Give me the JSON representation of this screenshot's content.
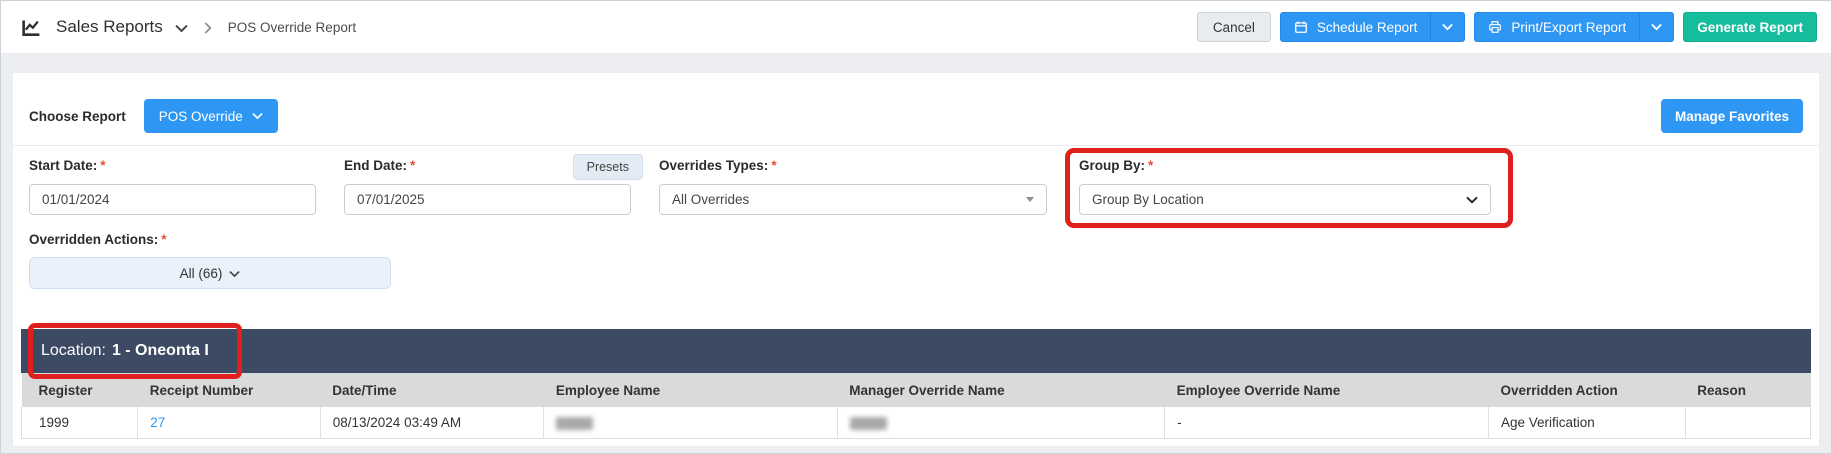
{
  "header": {
    "title": "Sales Reports",
    "breadcrumb": "POS Override Report",
    "cancel_label": "Cancel",
    "schedule_label": "Schedule Report",
    "print_export_label": "Print/Export Report",
    "generate_label": "Generate Report"
  },
  "toolbar": {
    "choose_report_label": "Choose Report",
    "report_selected": "POS Override",
    "manage_favorites_label": "Manage Favorites"
  },
  "filters": {
    "required_marker": "*",
    "start_date": {
      "label": "Start Date:",
      "value": "01/01/2024"
    },
    "end_date": {
      "label": "End Date:",
      "value": "07/01/2025"
    },
    "presets_label": "Presets",
    "override_types": {
      "label": "Overrides Types:",
      "value": "All Overrides"
    },
    "group_by": {
      "label": "Group By:",
      "value": "Group By Location"
    },
    "overridden_actions": {
      "label": "Overridden Actions:",
      "value": "All (66)"
    }
  },
  "report": {
    "location_label": "Location:",
    "location_value": "1 - Oneonta I",
    "table": {
      "columns": [
        "Register",
        "Receipt Number",
        "Date/Time",
        "Employee Name",
        "Manager Override Name",
        "Employee Override Name",
        "Overridden Action",
        "Reason"
      ],
      "receipt_link_col": 1,
      "rows": [
        [
          "1999",
          "27",
          "08/13/2024 03:49 AM",
          {
            "redacted": true
          },
          {
            "redacted": true
          },
          "-",
          "Age Verification",
          ""
        ]
      ]
    }
  },
  "icons": {
    "brand": "line-chart-icon",
    "schedule": "calendar-icon",
    "print": "printer-icon",
    "dropdowns": "chevron-down-icon",
    "breadcrumb": "chevron-right-icon"
  },
  "colors": {
    "accent_blue": "#2e96f3",
    "accent_teal": "#16bd9c",
    "location_bar": "#3d4a63",
    "annotation_red": "#e0201e",
    "required_red": "#e74c3c",
    "link_blue": "#2e96f3"
  }
}
